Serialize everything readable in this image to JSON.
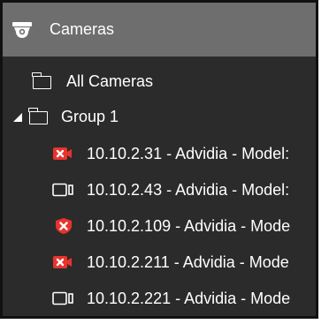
{
  "panel": {
    "title": "Cameras",
    "title_icon": "security-camera-icon"
  },
  "tree": {
    "all_cameras": "All Cameras",
    "group": "Group 1",
    "cameras": [
      {
        "label": "10.10.2.31 - Advidia - Model:",
        "status": "error",
        "icon": "camera-error-icon"
      },
      {
        "label": "10.10.2.43 - Advidia - Model:",
        "status": "ok",
        "icon": "video-camera-icon"
      },
      {
        "label": "10.10.2.109 - Advidia - Mode",
        "status": "alert",
        "icon": "shield-error-icon"
      },
      {
        "label": "10.10.2.211 - Advidia - Mode",
        "status": "error",
        "icon": "camera-error-icon"
      },
      {
        "label": "10.10.2.221 - Advidia - Mode",
        "status": "ok",
        "icon": "video-camera-icon"
      }
    ]
  },
  "colors": {
    "header_bg": "#6e6e6e",
    "panel_bg": "#2b2b2b",
    "error_red": "#e8332e"
  }
}
